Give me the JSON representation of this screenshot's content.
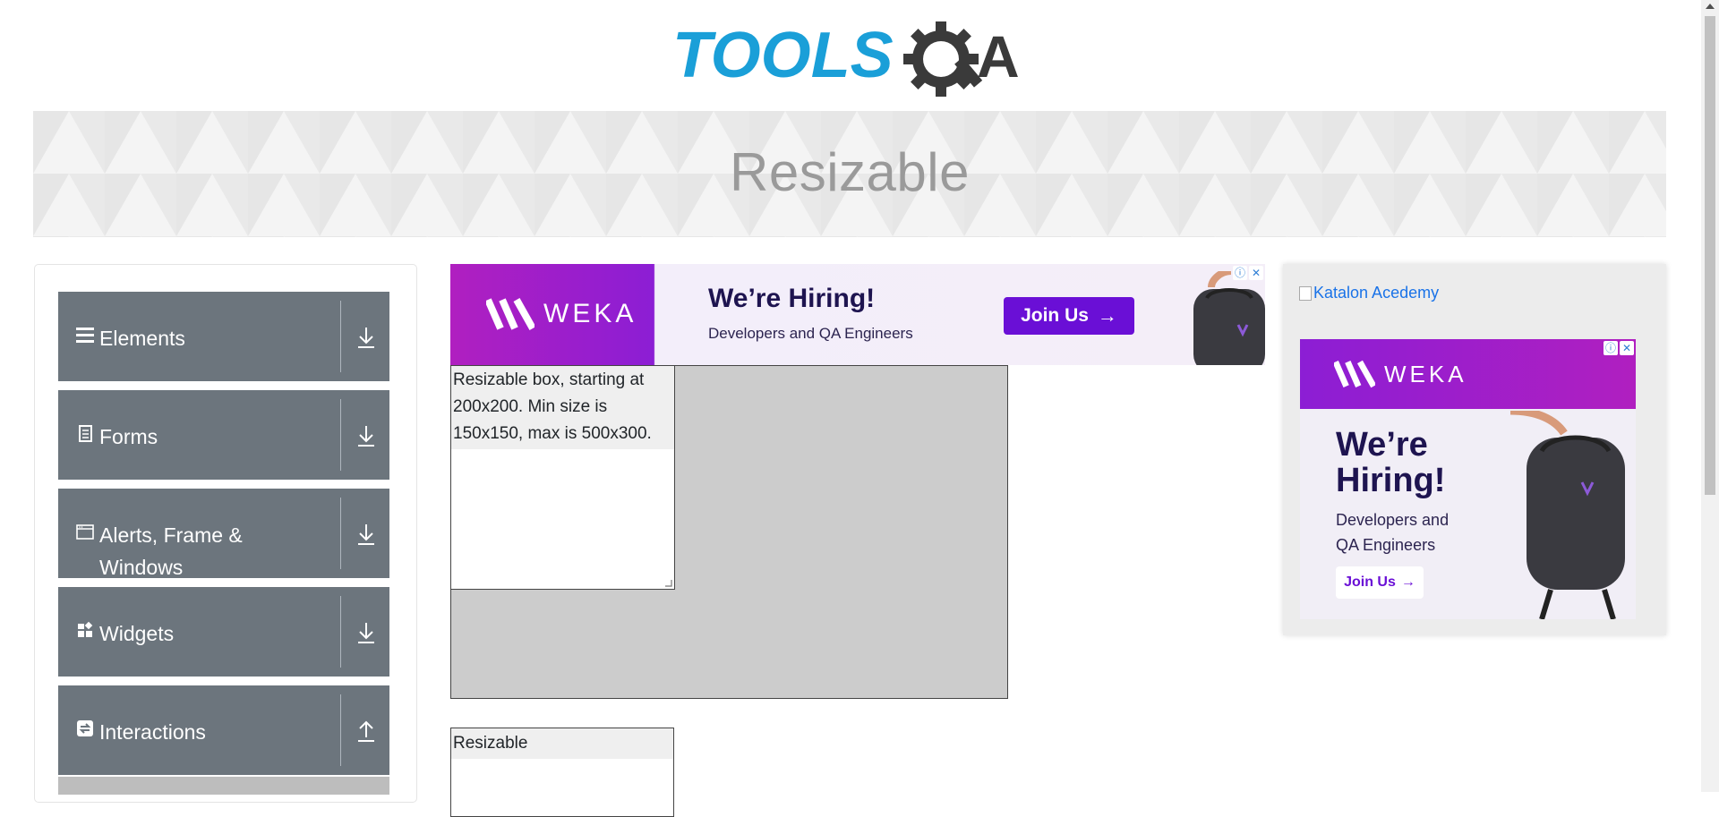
{
  "logo": {
    "part1": "TOOLS",
    "part2": "A"
  },
  "banner": {
    "title": "Resizable"
  },
  "sidebar": {
    "groups": [
      {
        "label": "Elements",
        "icon": "hamburger-icon",
        "arrow": "download-arrow-icon"
      },
      {
        "label": "Forms",
        "icon": "form-icon",
        "arrow": "download-arrow-icon"
      },
      {
        "label": "Alerts, Frame & Windows",
        "icon": "window-icon",
        "arrow": "download-arrow-icon"
      },
      {
        "label": "Widgets",
        "icon": "widgets-icon",
        "arrow": "download-arrow-icon"
      },
      {
        "label": "Interactions",
        "icon": "interactions-icon",
        "arrow": "upload-arrow-icon"
      }
    ]
  },
  "ad_top": {
    "brand": "WEKA",
    "headline": "We’re Hiring!",
    "subline": "Developers and QA Engineers",
    "cta": "Join Us"
  },
  "resizable_box": {
    "text": "Resizable box, starting at 200x200. Min size is 150x150, max is 500x300."
  },
  "resizable_two": {
    "text": "Resizable"
  },
  "right_ad": {
    "link_text": "Katalon Acedemy",
    "brand": "WEKA",
    "headline_line1": "We’re",
    "headline_line2": "Hiring!",
    "subline_line1": "Developers and",
    "subline_line2": "QA Engineers",
    "cta": "Join Us"
  },
  "colors": {
    "accent_blue": "#1a9fd8",
    "sidebar_bg": "#6c757d",
    "weka_purple": "#8c1ed4"
  }
}
